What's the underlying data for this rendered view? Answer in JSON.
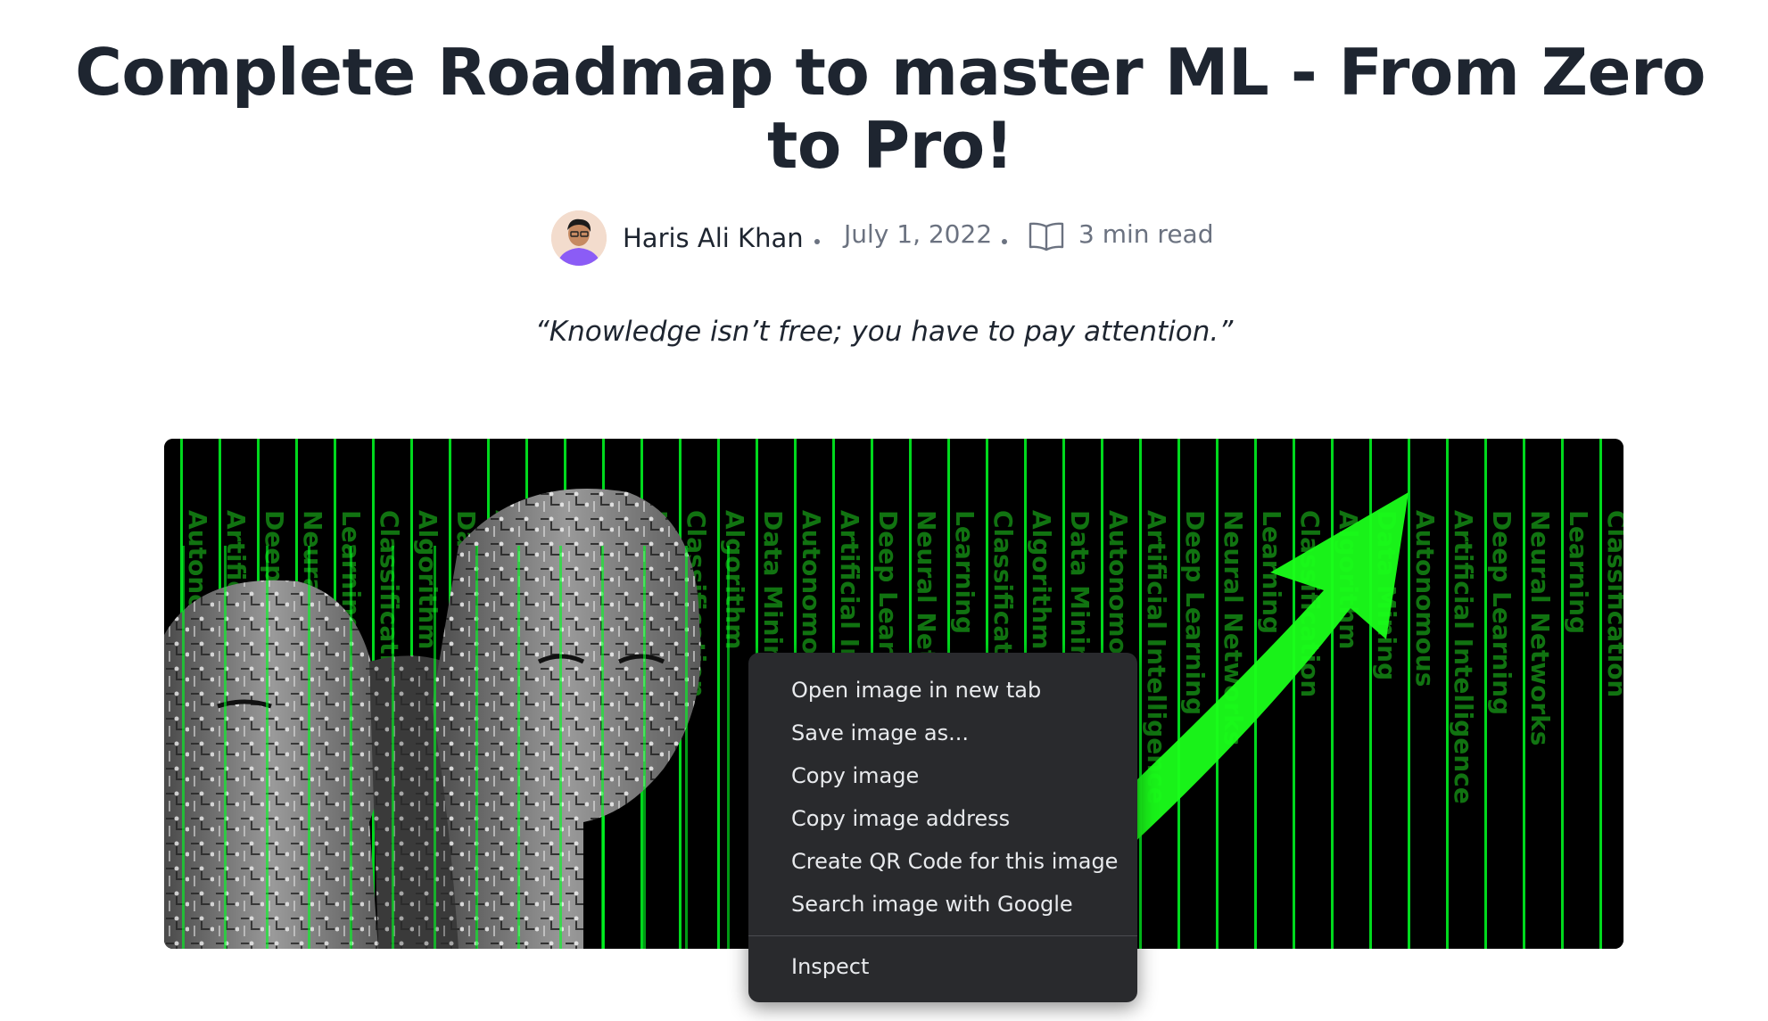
{
  "article": {
    "title": "Complete Roadmap to master ML - From Zero to Pro!",
    "author": "Haris Ali Khan",
    "date": "July 1, 2022",
    "read_time": "3 min read",
    "quote": "“Knowledge isn’t free; you have to pay attention.”"
  },
  "hero_image": {
    "word_columns": [
      "Autonomous",
      "Artificial Intelligence",
      "Deep Learning",
      "Neural Networks",
      "Learning",
      "Classification",
      "Algorithm",
      "Data Mining"
    ]
  },
  "context_menu": {
    "items": [
      {
        "label": "Open image in new tab"
      },
      {
        "label": "Save image as..."
      },
      {
        "label": "Copy image"
      },
      {
        "label": "Copy image address"
      },
      {
        "label": "Create QR Code for this image"
      },
      {
        "label": "Search image with Google"
      }
    ],
    "inspect_label": "Inspect"
  },
  "colors": {
    "text_dark": "#1e2530",
    "text_muted": "#6b7280",
    "menu_bg": "#292a2d",
    "menu_text": "#e8eaed",
    "matrix_green": "#00ff22"
  },
  "icons": {
    "read_time": "book-open-icon"
  }
}
